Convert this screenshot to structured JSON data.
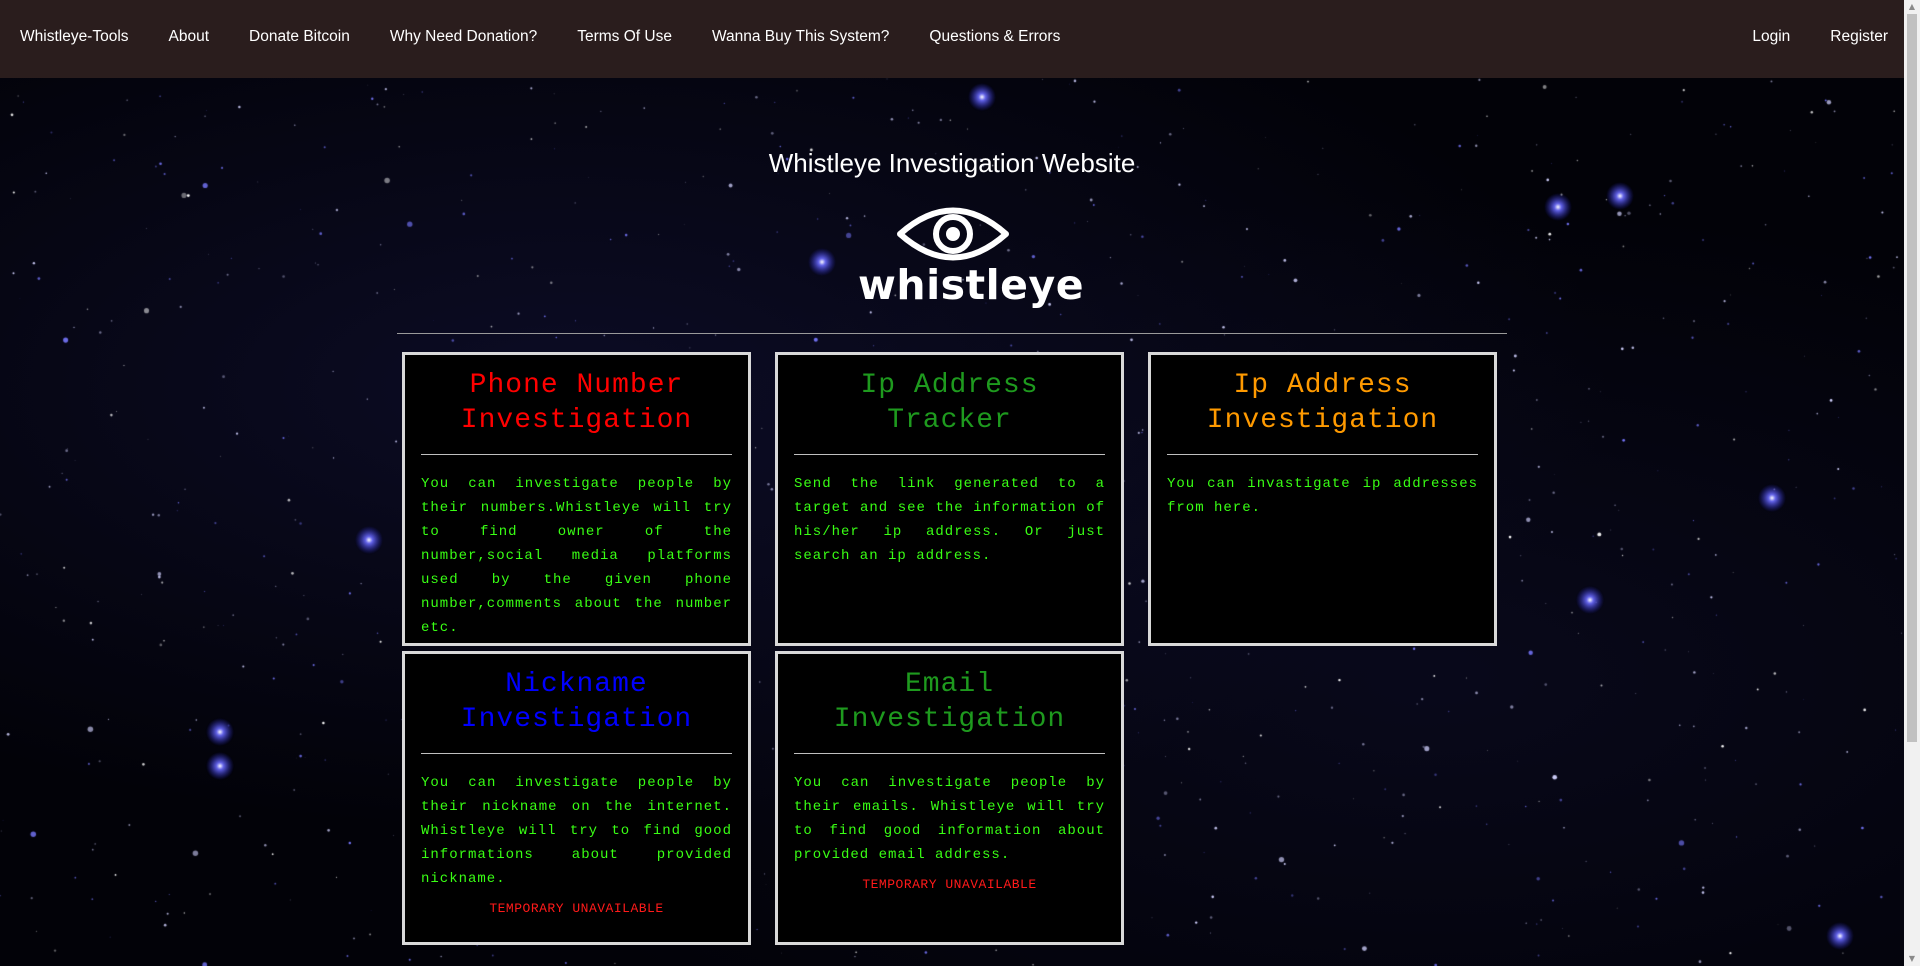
{
  "nav": {
    "left": [
      "Whistleye-Tools",
      "About",
      "Donate Bitcoin",
      "Why Need Donation?",
      "Terms Of Use",
      "Wanna Buy This System?",
      "Questions & Errors"
    ],
    "right": [
      "Login",
      "Register"
    ]
  },
  "header": {
    "title": "Whistleye Investigation Website",
    "logo_text": "whistleye"
  },
  "cards": [
    {
      "title": "Phone Number Investigation",
      "title_color": "#ff0000",
      "description": "You can investigate people by their numbers.Whistleye will try to find owner of the number,social media platforms used by the given phone number,comments about the number etc.",
      "status": ""
    },
    {
      "title": "Ip Address Tracker",
      "title_color": "#1e9a1e",
      "description": "Send the link generated to a target and see the information of his/her ip address. Or just search an ip address.",
      "status": ""
    },
    {
      "title": "Ip Address Investigation",
      "title_color": "#ff9a00",
      "description": "You can invastigate ip addresses from here.",
      "status": ""
    },
    {
      "title": "Nickname Investigation",
      "title_color": "#0000ff",
      "description": "You can investigate people by their nickname on the internet. Whistleye will try to find good informations about provided nickname.",
      "status": "TEMPORARY UNAVAILABLE"
    },
    {
      "title": "Email Investigation",
      "title_color": "#1e9a1e",
      "description": "You can investigate people by their emails. Whistleye will try to find good information about provided email address.",
      "status": "TEMPORARY UNAVAILABLE"
    }
  ],
  "colors": {
    "navbar_bg": "#2a1d1d",
    "description_text": "#39ff14",
    "status_text": "#ff1a1a",
    "card_border": "#d9d9d9"
  }
}
